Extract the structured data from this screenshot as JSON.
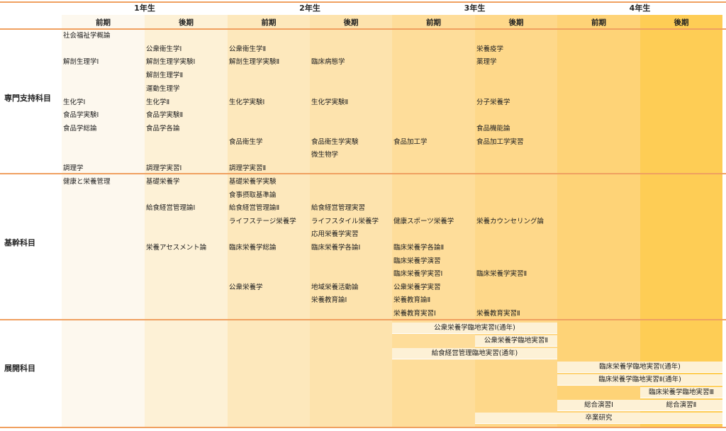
{
  "years": [
    "1年生",
    "2年生",
    "3年生",
    "4年生"
  ],
  "semesters": [
    "前期",
    "後期",
    "前期",
    "後期",
    "前期",
    "後期",
    "前期",
    "後期"
  ],
  "categories": {
    "specialized": "専門支持科目",
    "core": "基幹科目",
    "applied": "展開科目"
  },
  "specialized_items": [
    {
      "col": 0,
      "row": 0,
      "text": "社会福祉学概論"
    },
    {
      "col": 1,
      "row": 1,
      "text": "公衆衛生学Ⅰ"
    },
    {
      "col": 2,
      "row": 1,
      "text": "公衆衛生学Ⅱ"
    },
    {
      "col": 5,
      "row": 1,
      "text": "栄養疫学"
    },
    {
      "col": 0,
      "row": 2,
      "text": "解剖生理学Ⅰ"
    },
    {
      "col": 1,
      "row": 2,
      "text": "解剖生理学実験Ⅰ"
    },
    {
      "col": 2,
      "row": 2,
      "text": "解剖生理学実験Ⅱ"
    },
    {
      "col": 3,
      "row": 2,
      "text": "臨床病態学"
    },
    {
      "col": 5,
      "row": 2,
      "text": "薬理学"
    },
    {
      "col": 1,
      "row": 3,
      "text": "解剖生理学Ⅱ"
    },
    {
      "col": 1,
      "row": 4,
      "text": "運動生理学"
    },
    {
      "col": 0,
      "row": 5,
      "text": "生化学Ⅰ"
    },
    {
      "col": 1,
      "row": 5,
      "text": "生化学Ⅱ"
    },
    {
      "col": 2,
      "row": 5,
      "text": "生化学実験Ⅰ"
    },
    {
      "col": 3,
      "row": 5,
      "text": "生化学実験Ⅱ"
    },
    {
      "col": 5,
      "row": 5,
      "text": "分子栄養学"
    },
    {
      "col": 0,
      "row": 6,
      "text": "食品学実験Ⅰ"
    },
    {
      "col": 1,
      "row": 6,
      "text": "食品学実験Ⅱ"
    },
    {
      "col": 0,
      "row": 7,
      "text": "食品学総論"
    },
    {
      "col": 1,
      "row": 7,
      "text": "食品学各論"
    },
    {
      "col": 5,
      "row": 7,
      "text": "食品機能論"
    },
    {
      "col": 2,
      "row": 8,
      "text": "食品衛生学"
    },
    {
      "col": 3,
      "row": 8,
      "text": "食品衛生学実験"
    },
    {
      "col": 4,
      "row": 8,
      "text": "食品加工学"
    },
    {
      "col": 5,
      "row": 8,
      "text": "食品加工学実習"
    },
    {
      "col": 3,
      "row": 9,
      "text": "微生物学"
    },
    {
      "col": 0,
      "row": 10,
      "text": "調理学"
    },
    {
      "col": 1,
      "row": 10,
      "text": "調理学実習Ⅰ"
    },
    {
      "col": 2,
      "row": 10,
      "text": "調理学実習Ⅱ"
    }
  ],
  "core_items": [
    {
      "col": 0,
      "row": 0,
      "text": "健康と栄養管理"
    },
    {
      "col": 1,
      "row": 0,
      "text": "基礎栄養学"
    },
    {
      "col": 2,
      "row": 0,
      "text": "基礎栄養学実験"
    },
    {
      "col": 2,
      "row": 1,
      "text": "食事摂取基準論"
    },
    {
      "col": 1,
      "row": 2,
      "text": "給食経営管理論Ⅰ"
    },
    {
      "col": 2,
      "row": 2,
      "text": "給食経営管理論Ⅱ"
    },
    {
      "col": 3,
      "row": 2,
      "text": "給食経営管理実習"
    },
    {
      "col": 2,
      "row": 3,
      "text": "ライフステージ栄養学"
    },
    {
      "col": 3,
      "row": 3,
      "text": "ライフスタイル栄養学"
    },
    {
      "col": 4,
      "row": 3,
      "text": "健康スポーツ栄養学"
    },
    {
      "col": 5,
      "row": 3,
      "text": "栄養カウンセリング論"
    },
    {
      "col": 3,
      "row": 4,
      "text": "応用栄養学実習"
    },
    {
      "col": 1,
      "row": 5,
      "text": "栄養アセスメント論"
    },
    {
      "col": 2,
      "row": 5,
      "text": "臨床栄養学総論"
    },
    {
      "col": 3,
      "row": 5,
      "text": "臨床栄養学各論Ⅰ"
    },
    {
      "col": 4,
      "row": 5,
      "text": "臨床栄養学各論Ⅱ"
    },
    {
      "col": 4,
      "row": 6,
      "text": "臨床栄養学演習"
    },
    {
      "col": 4,
      "row": 7,
      "text": "臨床栄養学実習Ⅰ"
    },
    {
      "col": 5,
      "row": 7,
      "text": "臨床栄養学実習Ⅱ"
    },
    {
      "col": 2,
      "row": 8,
      "text": "公衆栄養学"
    },
    {
      "col": 3,
      "row": 8,
      "text": "地域栄養活動論"
    },
    {
      "col": 4,
      "row": 8,
      "text": "公衆栄養学実習"
    },
    {
      "col": 3,
      "row": 9,
      "text": "栄養教育論Ⅰ"
    },
    {
      "col": 4,
      "row": 9,
      "text": "栄養教育論Ⅱ"
    },
    {
      "col": 4,
      "row": 10,
      "text": "栄養教育実習Ⅰ"
    },
    {
      "col": 5,
      "row": 10,
      "text": "栄養教育実習Ⅱ"
    }
  ],
  "applied_items": [
    {
      "from": 4,
      "to": 5,
      "row": 0,
      "text": "公衆栄養学臨地実習Ⅰ(通年)"
    },
    {
      "from": 5,
      "to": 5,
      "row": 1,
      "text": "公衆栄養学臨地実習Ⅱ"
    },
    {
      "from": 4,
      "to": 5,
      "row": 2,
      "text": "給食経営管理臨地実習(通年)"
    },
    {
      "from": 6,
      "to": 7,
      "row": 3,
      "text": "臨床栄養学臨地実習Ⅰ(通年)"
    },
    {
      "from": 6,
      "to": 7,
      "row": 4,
      "text": "臨床栄養学臨地実習Ⅱ(通年)"
    },
    {
      "from": 7,
      "to": 7,
      "row": 5,
      "text": "臨床栄養学臨地実習Ⅲ"
    },
    {
      "from": 6,
      "to": 6,
      "row": 6,
      "text": "総合演習Ⅰ"
    },
    {
      "from": 7,
      "to": 7,
      "row": 6,
      "text": "総合演習Ⅱ"
    },
    {
      "from": 5,
      "to": 7,
      "row": 7,
      "text": "卒業研究"
    }
  ],
  "colors": {
    "rule": "#f0a060",
    "columns": [
      "#fdf8ee",
      "#fdf1d6",
      "#fde8bc",
      "#fde3ad",
      "#fedd9a",
      "#fed88a",
      "#fed377",
      "#fecd55"
    ],
    "span_fill": "#fdf1d6"
  }
}
